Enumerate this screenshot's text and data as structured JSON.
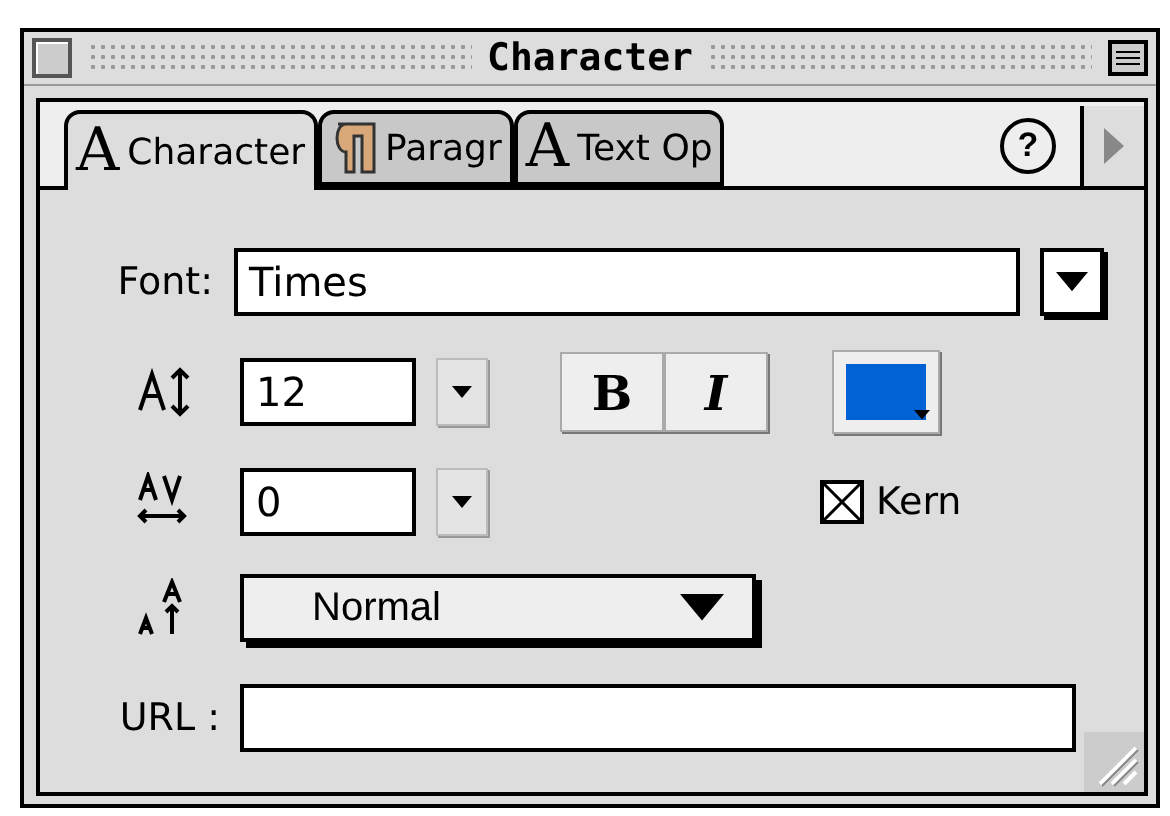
{
  "window": {
    "title": "Character"
  },
  "tabs": [
    {
      "glyph": "A",
      "label": "Character",
      "kind": "letter",
      "selected": true
    },
    {
      "label": "Paragr",
      "kind": "paragraph",
      "selected": false
    },
    {
      "glyph": "A",
      "label": "Text Op",
      "kind": "letter",
      "selected": false
    }
  ],
  "help_button": "?",
  "font": {
    "label": "Font:",
    "value": "Times"
  },
  "size": {
    "value": "12"
  },
  "bold": {
    "label": "B",
    "selected": false
  },
  "italic": {
    "label": "I",
    "selected": false
  },
  "text_color": {
    "color": "#0062d4"
  },
  "tracking": {
    "value": "0"
  },
  "kern": {
    "label": "Kern",
    "checked": true
  },
  "baseline": {
    "value": "Normal"
  },
  "url": {
    "label": "URL :"
  }
}
